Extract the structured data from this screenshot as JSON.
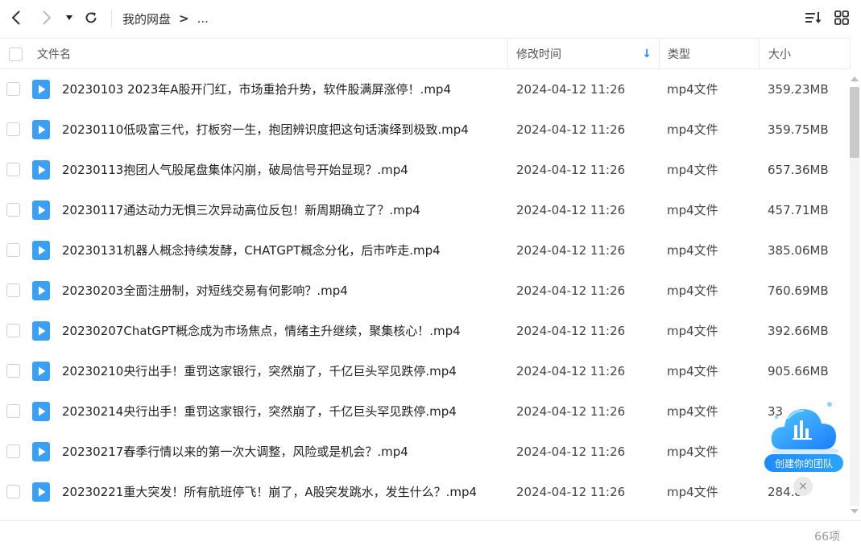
{
  "toolbar": {
    "breadcrumb_root": "我的网盘",
    "breadcrumb_sep": ">",
    "breadcrumb_more": "..."
  },
  "columns": {
    "name": "文件名",
    "modified": "修改时间",
    "type": "类型",
    "size": "大小",
    "sort_indicator": "↓"
  },
  "files": [
    {
      "name": "20230103 2023年A股开门红，市场重拾升势，软件股满屏涨停！.mp4",
      "modified": "2024-04-12 11:26",
      "type": "mp4文件",
      "size": "359.23MB"
    },
    {
      "name": "20230110低吸富三代，打板穷一生，抱团辨识度把这句话演绎到极致.mp4",
      "modified": "2024-04-12 11:26",
      "type": "mp4文件",
      "size": "359.75MB"
    },
    {
      "name": "20230113抱团人气股尾盘集体闪崩，破局信号开始显现？.mp4",
      "modified": "2024-04-12 11:26",
      "type": "mp4文件",
      "size": "657.36MB"
    },
    {
      "name": "20230117通达动力无惧三次异动高位反包！新周期确立了？.mp4",
      "modified": "2024-04-12 11:26",
      "type": "mp4文件",
      "size": "457.71MB"
    },
    {
      "name": "20230131机器人概念持续发酵，CHATGPT概念分化，后市咋走.mp4",
      "modified": "2024-04-12 11:26",
      "type": "mp4文件",
      "size": "385.06MB"
    },
    {
      "name": "20230203全面注册制，对短线交易有何影响？.mp4",
      "modified": "2024-04-12 11:26",
      "type": "mp4文件",
      "size": "760.69MB"
    },
    {
      "name": "20230207ChatGPT概念成为市场焦点，情绪主升继续，聚集核心！.mp4",
      "modified": "2024-04-12 11:26",
      "type": "mp4文件",
      "size": "392.66MB"
    },
    {
      "name": "20230210央行出手！重罚这家银行，突然崩了，千亿巨头罕见跌停.mp4",
      "modified": "2024-04-12 11:26",
      "type": "mp4文件",
      "size": "905.66MB"
    },
    {
      "name": "20230214央行出手！重罚这家银行，突然崩了，千亿巨头罕见跌停.mp4",
      "modified": "2024-04-12 11:26",
      "type": "mp4文件",
      "size": "33"
    },
    {
      "name": "20230217春季行情以来的第一次大调整，风险或是机会？.mp4",
      "modified": "2024-04-12 11:26",
      "type": "mp4文件",
      "size": ""
    },
    {
      "name": "20230221重大突发！所有航班停飞！崩了，A股突发跳水，发生什么？.mp4",
      "modified": "2024-04-12 11:26",
      "type": "mp4文件",
      "size": "284.8"
    }
  ],
  "footer": {
    "count": "66项"
  },
  "widget": {
    "label": "创建你的团队",
    "close": "×"
  },
  "colors": {
    "accent": "#1e8bff",
    "file_icon": "#3aa0f5"
  }
}
